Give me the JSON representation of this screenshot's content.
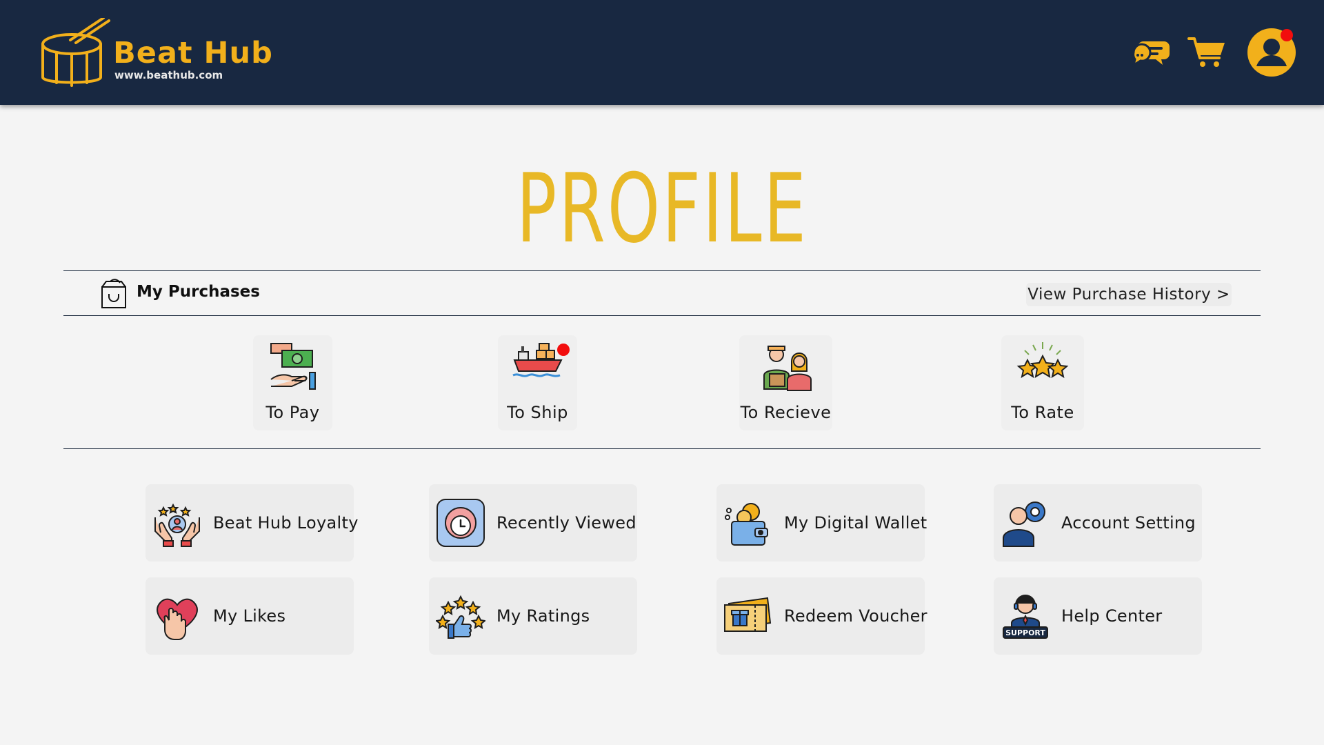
{
  "header": {
    "brand_name": "Beat Hub",
    "brand_url": "www.beathub.com",
    "icons": [
      "chat-icon",
      "cart-icon",
      "user-avatar-icon"
    ],
    "accent_color": "#f2b01b",
    "background_color": "#182841",
    "notification_color": "#f20d0d"
  },
  "page": {
    "title": "PROFILE",
    "title_color": "#e8b826"
  },
  "purchases": {
    "label": "My Purchases",
    "history_link": "View Purchase History >",
    "statuses": [
      {
        "label": "To Pay",
        "icon": "money-hand-icon",
        "notification": false
      },
      {
        "label": "To Ship",
        "icon": "cargo-ship-icon",
        "notification": true
      },
      {
        "label": "To Recieve",
        "icon": "delivery-people-icon",
        "notification": false
      },
      {
        "label": "To Rate",
        "icon": "stars-rating-icon",
        "notification": false
      }
    ]
  },
  "menu": {
    "items": [
      {
        "label": "Beat Hub Loyalty",
        "icon": "loyalty-hands-icon"
      },
      {
        "label": "Recently Viewed",
        "icon": "clock-history-icon"
      },
      {
        "label": "My Digital Wallet",
        "icon": "digital-wallet-icon"
      },
      {
        "label": "Account Setting",
        "icon": "user-gear-icon"
      },
      {
        "label": "My Likes",
        "icon": "heart-hand-icon"
      },
      {
        "label": "My Ratings",
        "icon": "thumbs-up-stars-icon"
      },
      {
        "label": "Redeem Voucher",
        "icon": "gift-voucher-icon"
      },
      {
        "label": "Help Center",
        "icon": "support-agent-icon"
      }
    ]
  }
}
